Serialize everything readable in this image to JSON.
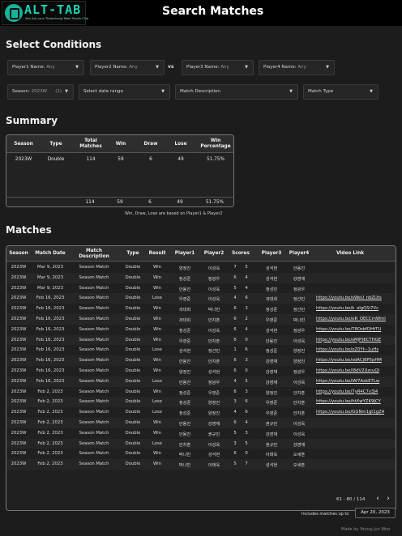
{
  "header": {
    "logo_text": "ALT-TAB",
    "logo_subtitle": "Seo Suk-ryun Tteokchang Table Tennis Club",
    "title": "Search Matches"
  },
  "select_conditions": {
    "title": "Select Conditions",
    "player1": {
      "label": "Player1 Name:",
      "value": "Any"
    },
    "player2": {
      "label": "Player2 Name:",
      "value": "Any"
    },
    "vs_label": "vs",
    "player3": {
      "label": "Player3 Name:",
      "value": "Any"
    },
    "player4": {
      "label": "Player4 Name:",
      "value": "Any"
    },
    "season": {
      "label": "Season:",
      "value": "2023W",
      "count": "(1)"
    },
    "date_range_placeholder": "Select date range",
    "match_description_placeholder": "Match Description",
    "match_type_placeholder": "Match Type"
  },
  "summary": {
    "title": "Summary",
    "columns": [
      "Season",
      "Type",
      "Total Matches",
      "Win",
      "Draw",
      "Lose",
      "Win Percentage"
    ],
    "row": [
      "2023W",
      "Double",
      "114",
      "59",
      "6",
      "49",
      "51.75%"
    ],
    "totals": [
      "114",
      "59",
      "6",
      "49",
      "51.75%"
    ],
    "note": "Win, Draw, Lose are based on Player1 & Player2"
  },
  "matches": {
    "title": "Matches",
    "columns": [
      "Season",
      "Match Date",
      "Match Description",
      "Type",
      "Result",
      "Player1",
      "Player2",
      "Scores",
      "",
      "Player3",
      "Player4",
      "Video Link"
    ],
    "rows": [
      [
        "2023W",
        "Mar 9, 2023",
        "Season Match",
        "Double",
        "Win",
        "양정진",
        "이성욱",
        "7",
        "5",
        "성석현",
        "안용진",
        ""
      ],
      [
        "2023W",
        "Mar 9, 2023",
        "Season Match",
        "Double",
        "Win",
        "정성준",
        "정광우",
        "6",
        "4",
        "성석현",
        "강영재",
        ""
      ],
      [
        "2023W",
        "Mar 9, 2023",
        "Season Match",
        "Double",
        "Win",
        "안용진",
        "이성욱",
        "5",
        "4",
        "정성민",
        "정광우",
        ""
      ],
      [
        "2023W",
        "Feb 16, 2023",
        "Season Match",
        "Double",
        "Lose",
        "우영준",
        "이성욱",
        "4",
        "6",
        "곽대희",
        "정선민",
        "https://youtu.be/sWeU_nbZUts"
      ],
      [
        "2023W",
        "Feb 16, 2023",
        "Season Match",
        "Double",
        "Win",
        "곽대희",
        "박나빈",
        "6",
        "3",
        "정성준",
        "정선민",
        "https://youtu.be/k_aIgQSi7Vc"
      ],
      [
        "2023W",
        "Feb 16, 2023",
        "Season Match",
        "Double",
        "Win",
        "곽대희",
        "안치훈",
        "6",
        "2",
        "우영준",
        "박나빈",
        "https://youtu.be/eR_OECCmWmI"
      ],
      [
        "2023W",
        "Feb 16, 2023",
        "Season Match",
        "Double",
        "Win",
        "정성준",
        "이성욱",
        "6",
        "4",
        "성석현",
        "정광우",
        "https://youtu.be/T8OsbfDHtTU"
      ],
      [
        "2023W",
        "Feb 16, 2023",
        "Season Match",
        "Double",
        "Win",
        "우영준",
        "안치훈",
        "6",
        "0",
        "안용진",
        "이성욱",
        "https://youtu.be/sMjP)6CTHGE"
      ],
      [
        "2023W",
        "Feb 16, 2023",
        "Season Match",
        "Double",
        "Lose",
        "성석현",
        "정선민",
        "1",
        "6",
        "정성준",
        "양정진",
        "https://youtu.be/oZ0Yt--1uHs"
      ],
      [
        "2023W",
        "Feb 16, 2023",
        "Season Match",
        "Double",
        "Win",
        "안용진",
        "안치훈",
        "6",
        "3",
        "강영재",
        "양정진",
        "https://youtu.be/sdACj6P5pHM"
      ],
      [
        "2023W",
        "Feb 16, 2023",
        "Season Match",
        "Double",
        "Win",
        "양정진",
        "성석현",
        "6",
        "0",
        "강영재",
        "정광우",
        "https://youtu.be/i8dV2UzcuQI"
      ],
      [
        "2023W",
        "Feb 16, 2023",
        "Season Match",
        "Double",
        "Lose",
        "안용진",
        "정광우",
        "4",
        "5",
        "강영재",
        "이성욱",
        "https://youtu.be/lAf7AxkE7Lw"
      ],
      [
        "2023W",
        "Feb 2, 2023",
        "Season Match",
        "Double",
        "Win",
        "정성준",
        "우영준",
        "6",
        "3",
        "양정진",
        "안치훈",
        "https://youtu.be/7yR4C7v3J4"
      ],
      [
        "2023W",
        "Feb 2, 2023",
        "Season Match",
        "Double",
        "Lose",
        "정성준",
        "양정진",
        "3",
        "6",
        "우영준",
        "안치훈",
        "https://youtu.be/htXwYZK9JCY"
      ],
      [
        "2023W",
        "Feb 2, 2023",
        "Season Match",
        "Double",
        "Lose",
        "정성준",
        "양정진",
        "4",
        "6",
        "우영준",
        "안치훈",
        "https://youtu.be/GGNm1gt1gZ4"
      ],
      [
        "2023W",
        "Feb 2, 2023",
        "Season Match",
        "Double",
        "Win",
        "안용진",
        "강영재",
        "6",
        "4",
        "권규민",
        "이성욱",
        ""
      ],
      [
        "2023W",
        "Feb 2, 2023",
        "Season Match",
        "Double",
        "Win",
        "안용진",
        "권규민",
        "5",
        "3",
        "강영재",
        "이성욱",
        ""
      ],
      [
        "2023W",
        "Feb 2, 2023",
        "Season Match",
        "Double",
        "Lose",
        "안치훈",
        "이성욱",
        "3",
        "5",
        "권규민",
        "강영재",
        ""
      ],
      [
        "2023W",
        "Feb 2, 2023",
        "Season Match",
        "Double",
        "Win",
        "박나빈",
        "성석현",
        "6",
        "0",
        "이태욱",
        "오세훈",
        ""
      ],
      [
        "2023W",
        "Feb 2, 2023",
        "Season Match",
        "Double",
        "Win",
        "박나빈",
        "이태욱",
        "5",
        "7",
        "성석현",
        "오세훈",
        ""
      ]
    ],
    "pagination": "61 - 80 / 114",
    "prev_icon": "chevron-left-icon",
    "next_icon": "chevron-right-icon",
    "includes_label": "Includes matches up to",
    "includes_date": "Apr 20, 2023"
  },
  "footer": {
    "credit": "Made by Young-Jun Woo"
  },
  "colors": {
    "brand": "#1fd1b4",
    "background": "#1c1c1c",
    "header": "#000000"
  }
}
